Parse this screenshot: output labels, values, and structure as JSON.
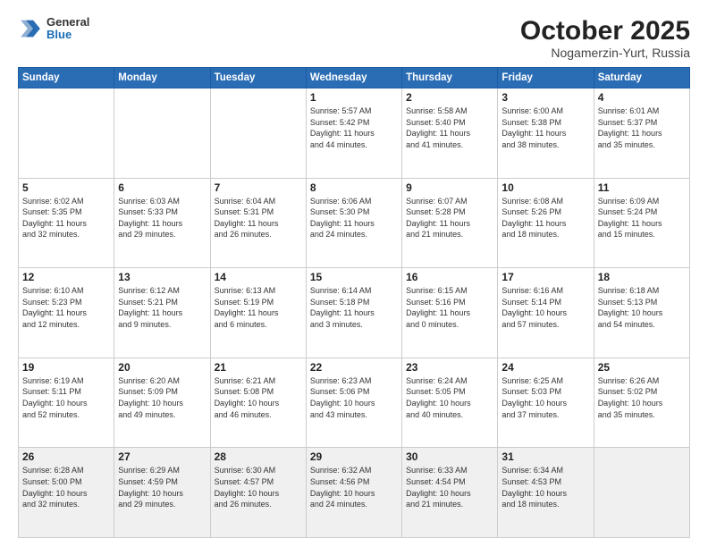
{
  "logo": {
    "general": "General",
    "blue": "Blue"
  },
  "header": {
    "month": "October 2025",
    "location": "Nogamerzin-Yurt, Russia"
  },
  "weekdays": [
    "Sunday",
    "Monday",
    "Tuesday",
    "Wednesday",
    "Thursday",
    "Friday",
    "Saturday"
  ],
  "weeks": [
    [
      {
        "day": "",
        "info": ""
      },
      {
        "day": "",
        "info": ""
      },
      {
        "day": "",
        "info": ""
      },
      {
        "day": "1",
        "info": "Sunrise: 5:57 AM\nSunset: 5:42 PM\nDaylight: 11 hours\nand 44 minutes."
      },
      {
        "day": "2",
        "info": "Sunrise: 5:58 AM\nSunset: 5:40 PM\nDaylight: 11 hours\nand 41 minutes."
      },
      {
        "day": "3",
        "info": "Sunrise: 6:00 AM\nSunset: 5:38 PM\nDaylight: 11 hours\nand 38 minutes."
      },
      {
        "day": "4",
        "info": "Sunrise: 6:01 AM\nSunset: 5:37 PM\nDaylight: 11 hours\nand 35 minutes."
      }
    ],
    [
      {
        "day": "5",
        "info": "Sunrise: 6:02 AM\nSunset: 5:35 PM\nDaylight: 11 hours\nand 32 minutes."
      },
      {
        "day": "6",
        "info": "Sunrise: 6:03 AM\nSunset: 5:33 PM\nDaylight: 11 hours\nand 29 minutes."
      },
      {
        "day": "7",
        "info": "Sunrise: 6:04 AM\nSunset: 5:31 PM\nDaylight: 11 hours\nand 26 minutes."
      },
      {
        "day": "8",
        "info": "Sunrise: 6:06 AM\nSunset: 5:30 PM\nDaylight: 11 hours\nand 24 minutes."
      },
      {
        "day": "9",
        "info": "Sunrise: 6:07 AM\nSunset: 5:28 PM\nDaylight: 11 hours\nand 21 minutes."
      },
      {
        "day": "10",
        "info": "Sunrise: 6:08 AM\nSunset: 5:26 PM\nDaylight: 11 hours\nand 18 minutes."
      },
      {
        "day": "11",
        "info": "Sunrise: 6:09 AM\nSunset: 5:24 PM\nDaylight: 11 hours\nand 15 minutes."
      }
    ],
    [
      {
        "day": "12",
        "info": "Sunrise: 6:10 AM\nSunset: 5:23 PM\nDaylight: 11 hours\nand 12 minutes."
      },
      {
        "day": "13",
        "info": "Sunrise: 6:12 AM\nSunset: 5:21 PM\nDaylight: 11 hours\nand 9 minutes."
      },
      {
        "day": "14",
        "info": "Sunrise: 6:13 AM\nSunset: 5:19 PM\nDaylight: 11 hours\nand 6 minutes."
      },
      {
        "day": "15",
        "info": "Sunrise: 6:14 AM\nSunset: 5:18 PM\nDaylight: 11 hours\nand 3 minutes."
      },
      {
        "day": "16",
        "info": "Sunrise: 6:15 AM\nSunset: 5:16 PM\nDaylight: 11 hours\nand 0 minutes."
      },
      {
        "day": "17",
        "info": "Sunrise: 6:16 AM\nSunset: 5:14 PM\nDaylight: 10 hours\nand 57 minutes."
      },
      {
        "day": "18",
        "info": "Sunrise: 6:18 AM\nSunset: 5:13 PM\nDaylight: 10 hours\nand 54 minutes."
      }
    ],
    [
      {
        "day": "19",
        "info": "Sunrise: 6:19 AM\nSunset: 5:11 PM\nDaylight: 10 hours\nand 52 minutes."
      },
      {
        "day": "20",
        "info": "Sunrise: 6:20 AM\nSunset: 5:09 PM\nDaylight: 10 hours\nand 49 minutes."
      },
      {
        "day": "21",
        "info": "Sunrise: 6:21 AM\nSunset: 5:08 PM\nDaylight: 10 hours\nand 46 minutes."
      },
      {
        "day": "22",
        "info": "Sunrise: 6:23 AM\nSunset: 5:06 PM\nDaylight: 10 hours\nand 43 minutes."
      },
      {
        "day": "23",
        "info": "Sunrise: 6:24 AM\nSunset: 5:05 PM\nDaylight: 10 hours\nand 40 minutes."
      },
      {
        "day": "24",
        "info": "Sunrise: 6:25 AM\nSunset: 5:03 PM\nDaylight: 10 hours\nand 37 minutes."
      },
      {
        "day": "25",
        "info": "Sunrise: 6:26 AM\nSunset: 5:02 PM\nDaylight: 10 hours\nand 35 minutes."
      }
    ],
    [
      {
        "day": "26",
        "info": "Sunrise: 6:28 AM\nSunset: 5:00 PM\nDaylight: 10 hours\nand 32 minutes."
      },
      {
        "day": "27",
        "info": "Sunrise: 6:29 AM\nSunset: 4:59 PM\nDaylight: 10 hours\nand 29 minutes."
      },
      {
        "day": "28",
        "info": "Sunrise: 6:30 AM\nSunset: 4:57 PM\nDaylight: 10 hours\nand 26 minutes."
      },
      {
        "day": "29",
        "info": "Sunrise: 6:32 AM\nSunset: 4:56 PM\nDaylight: 10 hours\nand 24 minutes."
      },
      {
        "day": "30",
        "info": "Sunrise: 6:33 AM\nSunset: 4:54 PM\nDaylight: 10 hours\nand 21 minutes."
      },
      {
        "day": "31",
        "info": "Sunrise: 6:34 AM\nSunset: 4:53 PM\nDaylight: 10 hours\nand 18 minutes."
      },
      {
        "day": "",
        "info": ""
      }
    ]
  ]
}
